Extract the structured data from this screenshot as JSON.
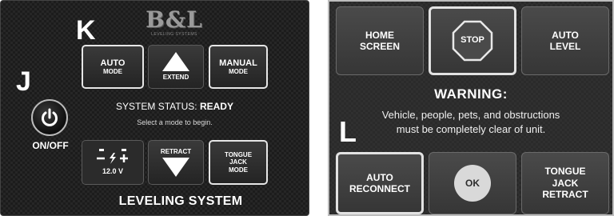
{
  "left_panel": {
    "brand": {
      "mark": "B&L",
      "tagline": "LEVELING SYSTEMS"
    },
    "callouts": {
      "k": "K",
      "j": "J"
    },
    "power": {
      "icon": "power-icon",
      "label": "ON/OFF"
    },
    "buttons": {
      "auto_mode": {
        "line1": "AUTO",
        "line2": "MODE"
      },
      "extend": {
        "label": "EXTEND",
        "icon": "arrow-up-icon"
      },
      "manual_mode": {
        "line1": "MANUAL",
        "line2": "MODE"
      },
      "battery": {
        "symbol": "— ⚡ +",
        "voltage": "12.0 V"
      },
      "retract": {
        "label": "RETRACT",
        "icon": "arrow-down-icon"
      },
      "tongue_jack_mode": {
        "line1": "TONGUE",
        "line2": "JACK",
        "line3": "MODE"
      }
    },
    "status": {
      "label": "SYSTEM STATUS:",
      "value": "READY",
      "hint": "Select a mode to begin."
    },
    "footer": "LEVELING SYSTEM"
  },
  "right_panel": {
    "buttons": {
      "home_screen": {
        "line1": "HOME",
        "line2": "SCREEN"
      },
      "stop": {
        "label": "STOP",
        "icon": "stop-sign-icon"
      },
      "auto_level": {
        "line1": "AUTO",
        "line2": "LEVEL"
      },
      "auto_reconnect": {
        "line1": "AUTO",
        "line2": "RECONNECT"
      },
      "ok": {
        "label": "OK"
      },
      "tongue_jack_retract": {
        "line1": "TONGUE",
        "line2": "JACK",
        "line3": "RETRACT"
      }
    },
    "warning": {
      "title": "WARNING:",
      "line1": "Vehicle, people, pets, and obstructions",
      "line2": "must be completely clear of unit."
    },
    "callout_l": "L"
  },
  "colors": {
    "panel_dark": "#1c1c1c",
    "panel_right": "#2a2a2a",
    "text": "#ffffff",
    "outline": "#e6e6e6"
  }
}
